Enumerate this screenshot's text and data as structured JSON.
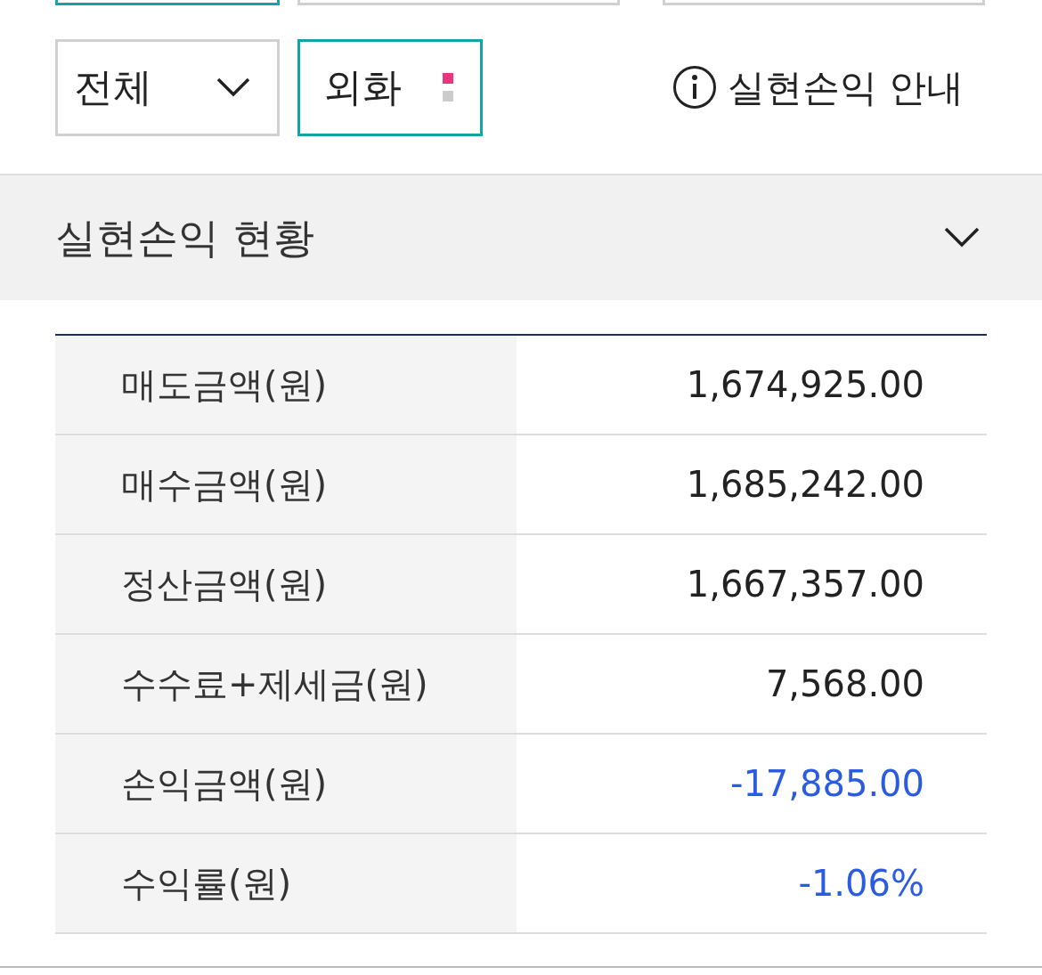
{
  "top_buttons": [
    {
      "selected": true
    },
    {
      "selected": false
    },
    {
      "selected": false
    }
  ],
  "filters": {
    "category": {
      "value": "전체"
    },
    "currency": {
      "value": "외화",
      "selected": true
    }
  },
  "info_link": "실현손익 안내",
  "section": {
    "title": "실현손익 현황",
    "expanded": true
  },
  "rows": [
    {
      "label": "매도금액(원)",
      "value": "1,674,925.00",
      "negative": false
    },
    {
      "label": "매수금액(원)",
      "value": "1,685,242.00",
      "negative": false
    },
    {
      "label": "정산금액(원)",
      "value": "1,667,357.00",
      "negative": false
    },
    {
      "label": "수수료+제세금(원)",
      "value": "7,568.00",
      "negative": false
    },
    {
      "label": "손익금액(원)",
      "value": "-17,885.00",
      "negative": true
    },
    {
      "label": "수익률(원)",
      "value": "-1.06%",
      "negative": true
    }
  ]
}
